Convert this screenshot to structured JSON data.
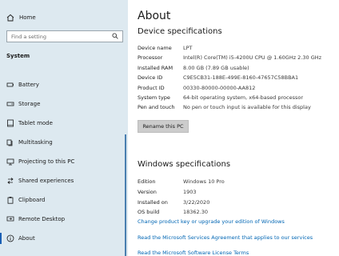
{
  "sidebar": {
    "home_label": "Home",
    "search_placeholder": "Find a setting",
    "section_title": "System",
    "items": [
      {
        "label": "Battery",
        "icon": "battery-icon"
      },
      {
        "label": "Storage",
        "icon": "storage-icon"
      },
      {
        "label": "Tablet mode",
        "icon": "tablet-mode-icon"
      },
      {
        "label": "Multitasking",
        "icon": "multitasking-icon"
      },
      {
        "label": "Projecting to this PC",
        "icon": "projecting-icon"
      },
      {
        "label": "Shared experiences",
        "icon": "shared-experiences-icon"
      },
      {
        "label": "Clipboard",
        "icon": "clipboard-icon"
      },
      {
        "label": "Remote Desktop",
        "icon": "remote-desktop-icon"
      },
      {
        "label": "About",
        "icon": "info-icon",
        "selected": true
      }
    ]
  },
  "main": {
    "title": "About",
    "device_specs": {
      "heading": "Device specifications",
      "rows": [
        {
          "key": "Device name",
          "value": "LPT"
        },
        {
          "key": "Processor",
          "value": "Intel(R) Core(TM) i5-4200U CPU @ 1.60GHz   2.30 GHz"
        },
        {
          "key": "Installed RAM",
          "value": "8.00 GB (7.89 GB usable)"
        },
        {
          "key": "Device ID",
          "value": "C9E5CB31-188E-499E-8160-47657C58BBA1"
        },
        {
          "key": "Product ID",
          "value": "00330-80000-00000-AA812"
        },
        {
          "key": "System type",
          "value": "64-bit operating system, x64-based processor"
        },
        {
          "key": "Pen and touch",
          "value": "No pen or touch input is available for this display"
        }
      ],
      "rename_button": "Rename this PC"
    },
    "windows_specs": {
      "heading": "Windows specifications",
      "rows": [
        {
          "key": "Edition",
          "value": "Windows 10 Pro"
        },
        {
          "key": "Version",
          "value": "1903"
        },
        {
          "key": "Installed on",
          "value": "3/22/2020"
        },
        {
          "key": "OS build",
          "value": "18362.30"
        }
      ],
      "links": [
        "Change product key or upgrade your edition of Windows",
        "Read the Microsoft Services Agreement that applies to our services",
        "Read the Microsoft Software License Terms"
      ]
    }
  },
  "colors": {
    "sidebar_bg": "#dde9f0",
    "accent": "#1a5fb4",
    "link": "#0066b4"
  }
}
